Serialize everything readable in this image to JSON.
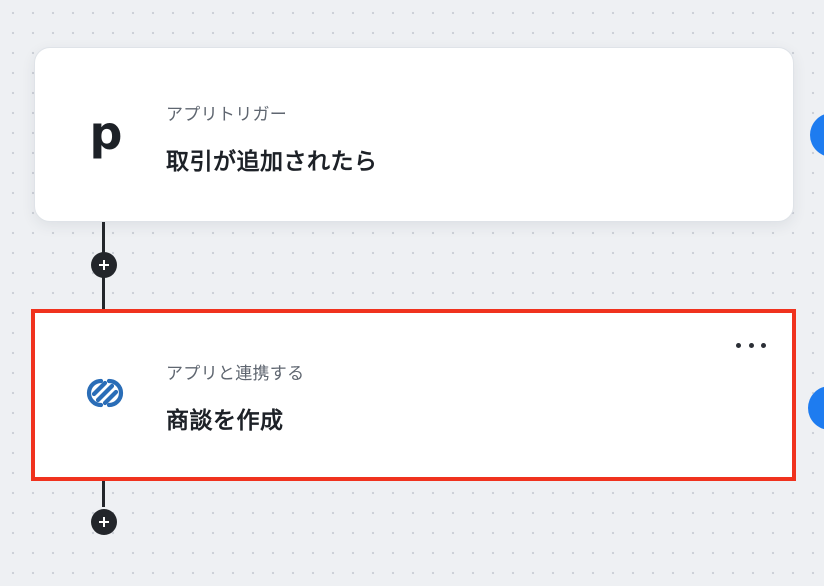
{
  "flow": {
    "trigger": {
      "app_icon": "pipedrive-logo-icon",
      "app_icon_letter": "p",
      "sublabel": "アプリトリガー",
      "title": "取引が追加されたら"
    },
    "action": {
      "app_icon": "zoho-crm-logo-icon",
      "sublabel": "アプリと連携する",
      "title": "商談を作成",
      "menu_icon": "more-horizontal-icon",
      "highlight_color": "#f0321e"
    },
    "add_step_icon": "plus-icon"
  },
  "colors": {
    "canvas_background": "#eef0f3",
    "connector": "#23262b",
    "handle_accent": "#1e7cf0",
    "zoho_blue": "#2a6db7"
  }
}
